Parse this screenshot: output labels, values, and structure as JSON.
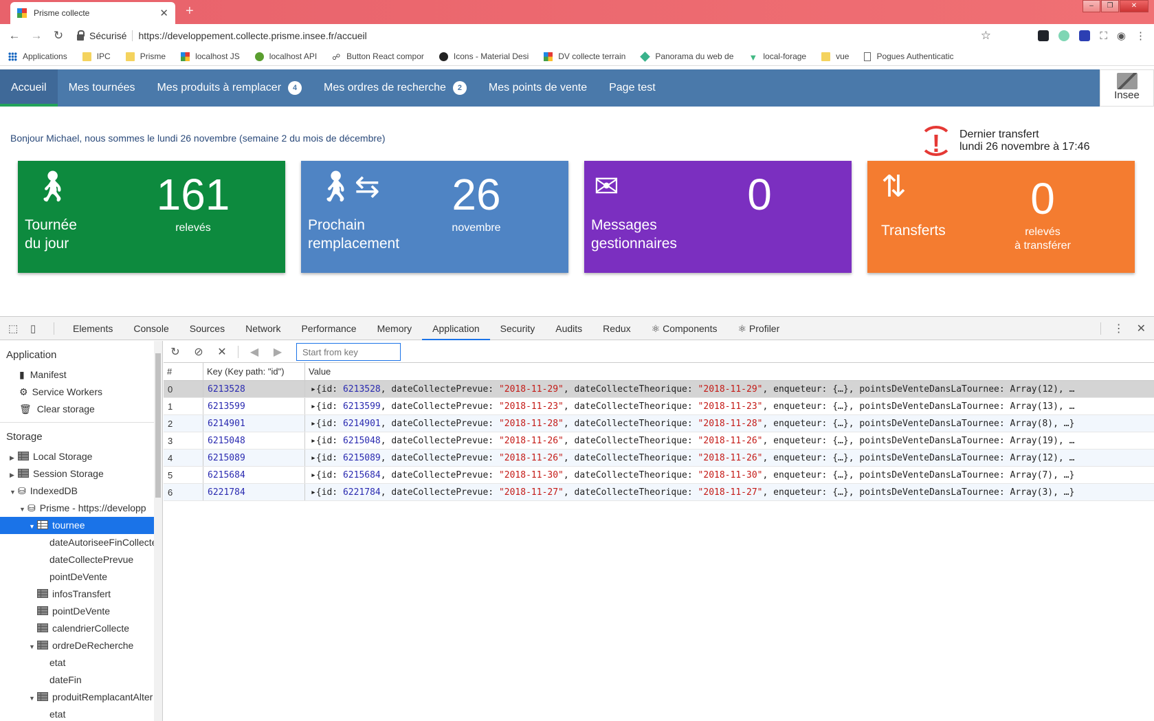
{
  "browser": {
    "tab_title": "Prisme collecte",
    "secure_label": "Sécurisé",
    "url": "https://developpement.collecte.prisme.insee.fr/accueil",
    "bookmarks": [
      "Applications",
      "IPC",
      "Prisme",
      "localhost JS",
      "localhost API",
      "Button React compor",
      "Icons - Material Desi",
      "DV collecte terrain",
      "Panorama du web de",
      "local-forage",
      "vue",
      "Pogues Authenticatic"
    ]
  },
  "app": {
    "nav": [
      {
        "label": "Accueil",
        "badge": ""
      },
      {
        "label": "Mes tournées",
        "badge": ""
      },
      {
        "label": "Mes produits à remplacer",
        "badge": "4"
      },
      {
        "label": "Mes ordres de recherche",
        "badge": "2"
      },
      {
        "label": "Mes points de vente",
        "badge": ""
      },
      {
        "label": "Page test",
        "badge": ""
      }
    ],
    "logo_text": "Insee",
    "greeting": "Bonjour Michael, nous sommes le lundi 26 novembre (semaine 2 du mois de décembre)",
    "last_transfer_title": "Dernier transfert",
    "last_transfer_date": "lundi 26 novembre à 17:46",
    "cards": [
      {
        "label1": "Tournée",
        "label2": "du jour",
        "value": "161",
        "unit1": "relevés",
        "unit2": "",
        "color": "#0d8a3e"
      },
      {
        "label1": "Prochain",
        "label2": "remplacement",
        "value": "26",
        "unit1": "novembre",
        "unit2": "",
        "color": "#4f84c4"
      },
      {
        "label1": "Messages",
        "label2": "gestionnaires",
        "value": "0",
        "unit1": "",
        "unit2": "",
        "color": "#7b2fc0"
      },
      {
        "label1": "Transferts",
        "label2": "",
        "value": "0",
        "unit1": "relevés",
        "unit2": "à transférer",
        "color": "#f47c30"
      }
    ]
  },
  "devtools": {
    "tabs": [
      "Elements",
      "Console",
      "Sources",
      "Network",
      "Performance",
      "Memory",
      "Application",
      "Security",
      "Audits",
      "Redux",
      "⚛ Components",
      "⚛ Profiler"
    ],
    "active_tab": "Application",
    "sidebar": {
      "application_header": "Application",
      "application_items": [
        "Manifest",
        "Service Workers",
        "Clear storage"
      ],
      "storage_header": "Storage",
      "local_storage": "Local Storage",
      "session_storage": "Session Storage",
      "indexeddb": "IndexedDB",
      "db_name": "Prisme - https://developp",
      "stores": [
        {
          "name": "tournee",
          "level": 3,
          "expanded": true,
          "selected": true,
          "icon": true
        },
        {
          "name": "dateAutoriseeFinCollecte",
          "level": 4,
          "icon": false
        },
        {
          "name": "dateCollectePrevue",
          "level": 4,
          "icon": false
        },
        {
          "name": "pointDeVente",
          "level": 4,
          "icon": false
        },
        {
          "name": "infosTransfert",
          "level": 3,
          "icon": true
        },
        {
          "name": "pointDeVente",
          "level": 3,
          "icon": true
        },
        {
          "name": "calendrierCollecte",
          "level": 3,
          "icon": true
        },
        {
          "name": "ordreDeRecherche",
          "level": 3,
          "expanded": true,
          "icon": true
        },
        {
          "name": "etat",
          "level": 4,
          "icon": false
        },
        {
          "name": "dateFin",
          "level": 4,
          "icon": false
        },
        {
          "name": "produitRemplacantAlter",
          "level": 3,
          "expanded": true,
          "icon": true
        },
        {
          "name": "etat",
          "level": 4,
          "icon": false
        }
      ]
    },
    "search_placeholder": "Start from key",
    "table": {
      "headers": [
        "#",
        "Key (Key path: \"id\")",
        "Value"
      ],
      "rows": [
        {
          "n": "0",
          "key": "6213528",
          "id": "6213528",
          "prevue": "\"2018-11-29\"",
          "theo": "\"2018-11-29\"",
          "pdv": "Array(12), …"
        },
        {
          "n": "1",
          "key": "6213599",
          "id": "6213599",
          "prevue": "\"2018-11-23\"",
          "theo": "\"2018-11-23\"",
          "pdv": "Array(13), …"
        },
        {
          "n": "2",
          "key": "6214901",
          "id": "6214901",
          "prevue": "\"2018-11-28\"",
          "theo": "\"2018-11-28\"",
          "pdv": "Array(8), …}"
        },
        {
          "n": "3",
          "key": "6215048",
          "id": "6215048",
          "prevue": "\"2018-11-26\"",
          "theo": "\"2018-11-26\"",
          "pdv": "Array(19), …"
        },
        {
          "n": "4",
          "key": "6215089",
          "id": "6215089",
          "prevue": "\"2018-11-26\"",
          "theo": "\"2018-11-26\"",
          "pdv": "Array(12), …"
        },
        {
          "n": "5",
          "key": "6215684",
          "id": "6215684",
          "prevue": "\"2018-11-30\"",
          "theo": "\"2018-11-30\"",
          "pdv": "Array(7), …}"
        },
        {
          "n": "6",
          "key": "6221784",
          "id": "6221784",
          "prevue": "\"2018-11-27\"",
          "theo": "\"2018-11-27\"",
          "pdv": "Array(3), …}"
        }
      ],
      "value_labels": {
        "id": "{id: ",
        "prevue": "dateCollectePrevue: ",
        "theo": "dateCollecteTheorique: ",
        "enq": "enqueteur: {…}, ",
        "pdv": "pointsDeVenteDansLaTournee: "
      }
    }
  }
}
